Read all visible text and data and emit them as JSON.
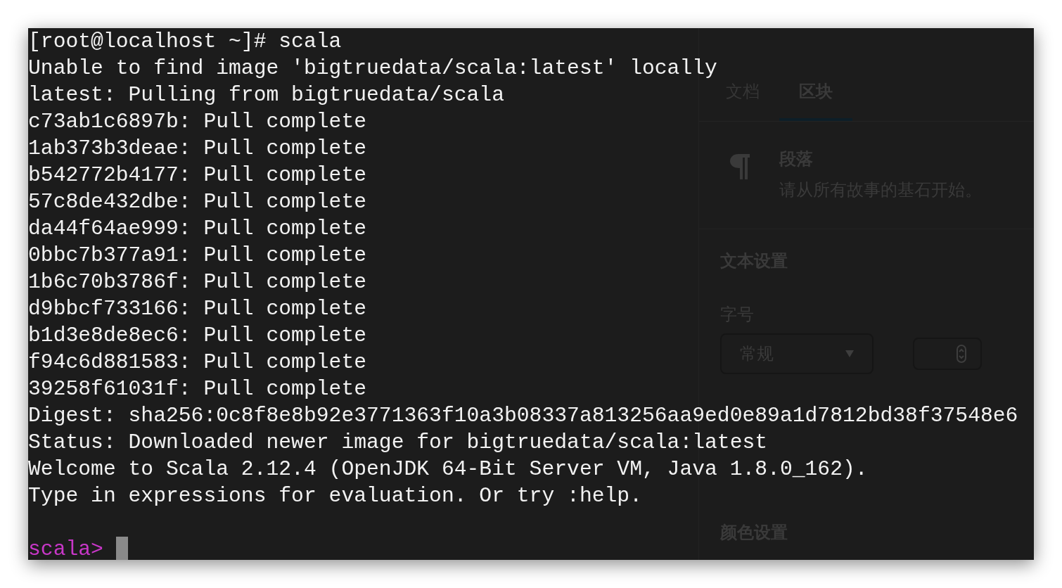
{
  "terminal": {
    "lines": [
      "[root@localhost ~]# scala",
      "Unable to find image 'bigtruedata/scala:latest' locally",
      "latest: Pulling from bigtruedata/scala",
      "c73ab1c6897b: Pull complete",
      "1ab373b3deae: Pull complete",
      "b542772b4177: Pull complete",
      "57c8de432dbe: Pull complete",
      "da44f64ae999: Pull complete",
      "0bbc7b377a91: Pull complete",
      "1b6c70b3786f: Pull complete",
      "d9bbcf733166: Pull complete",
      "b1d3e8de8ec6: Pull complete",
      "f94c6d881583: Pull complete",
      "39258f61031f: Pull complete",
      "Digest: sha256:0c8f8e8b92e3771363f10a3b08337a813256aa9ed0e89a1d7812bd38f37548e6",
      "Status: Downloaded newer image for bigtruedata/scala:latest",
      "Welcome to Scala 2.12.4 (OpenJDK 64-Bit Server VM, Java 1.8.0_162).",
      "Type in expressions for evaluation. Or try :help."
    ],
    "prompt": {
      "text": "scala>",
      "cursor": true
    }
  },
  "background_panel": {
    "tabs": [
      {
        "label": "文档",
        "selected": false
      },
      {
        "label": "区块",
        "selected": true
      }
    ],
    "block": {
      "title": "段落",
      "description": "请从所有故事的基石开始。"
    },
    "text_settings": {
      "heading": "文本设置",
      "font_size_label": "字号",
      "font_size_select": "常规"
    },
    "color_settings": {
      "heading": "颜色设置"
    }
  }
}
